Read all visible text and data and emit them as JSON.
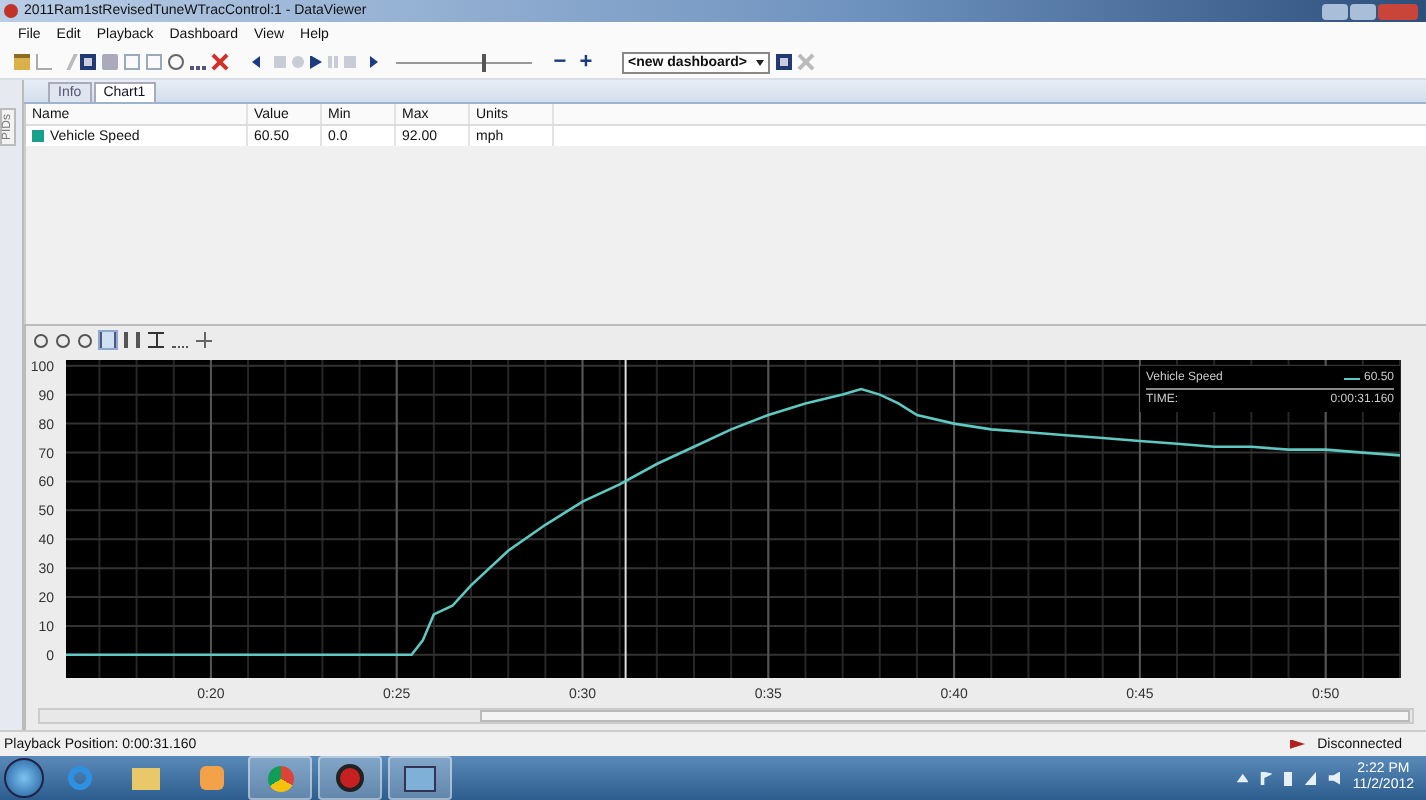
{
  "window": {
    "title": "2011Ram1stRevisedTuneWTracControl:1 - DataViewer"
  },
  "menu": [
    "File",
    "Edit",
    "Playback",
    "Dashboard",
    "View",
    "Help"
  ],
  "toolbar": {
    "playback_slider": {
      "level": 0.63
    },
    "zoom_out": "−",
    "zoom_in": "+",
    "dashboard": "<new dashboard>"
  },
  "side_tab": "PIDs",
  "tabs": [
    {
      "label": "Info",
      "selected": false
    },
    {
      "label": "Chart1",
      "selected": true
    }
  ],
  "table": {
    "columns": [
      "Name",
      "Value",
      "Min",
      "Max",
      "Units"
    ],
    "rows": [
      {
        "color": "#1aa08a",
        "cells": [
          "Vehicle Speed",
          "60.50",
          "0.0",
          "92.00",
          "mph"
        ]
      }
    ]
  },
  "chart": {
    "legend": {
      "value": "60.50",
      "time_label": "TIME:",
      "time": "0:00:31.160"
    },
    "chart_data": {
      "type": "line",
      "grid": true,
      "xlim": [
        16.1,
        52
      ],
      "ylim": [
        -8,
        102
      ],
      "yticks": [
        0,
        10,
        20,
        30,
        40,
        50,
        60,
        70,
        80,
        90,
        100
      ],
      "xticks": [
        {
          "value": 20,
          "label": "0:20"
        },
        {
          "value": 25,
          "label": "0:25"
        },
        {
          "value": 30,
          "label": "0:30"
        },
        {
          "value": 35,
          "label": "0:35"
        },
        {
          "value": 40,
          "label": "0:40"
        },
        {
          "value": 45,
          "label": "0:45"
        },
        {
          "value": 50,
          "label": "0:50"
        }
      ],
      "x": [
        16.1,
        25.4,
        25.7,
        26,
        26.5,
        27,
        28,
        29,
        30,
        31,
        32,
        33,
        34,
        35,
        36,
        37,
        37.5,
        38,
        38.5,
        39,
        40,
        41,
        42,
        43,
        44,
        45,
        46,
        47,
        48,
        49,
        50,
        51,
        52
      ],
      "series": [
        {
          "name": "Vehicle Speed",
          "color": "#5fc8c0",
          "values": [
            0,
            0,
            5,
            14,
            17,
            24,
            36,
            45,
            53,
            59,
            66,
            72,
            78,
            83,
            87,
            90,
            92,
            90,
            87,
            83,
            80,
            78,
            77,
            76,
            75,
            74,
            73,
            72,
            72,
            71,
            71,
            70,
            69
          ]
        }
      ],
      "ref_lines": [
        {
          "axis": "x",
          "value": 31.16,
          "color": "#dddddd"
        }
      ]
    }
  },
  "status_bar": {
    "position": "Playback Position: 0:00:31.160",
    "connection": "Disconnected"
  },
  "taskbar": {
    "time": "2:22 PM",
    "date": "11/2/2012"
  }
}
